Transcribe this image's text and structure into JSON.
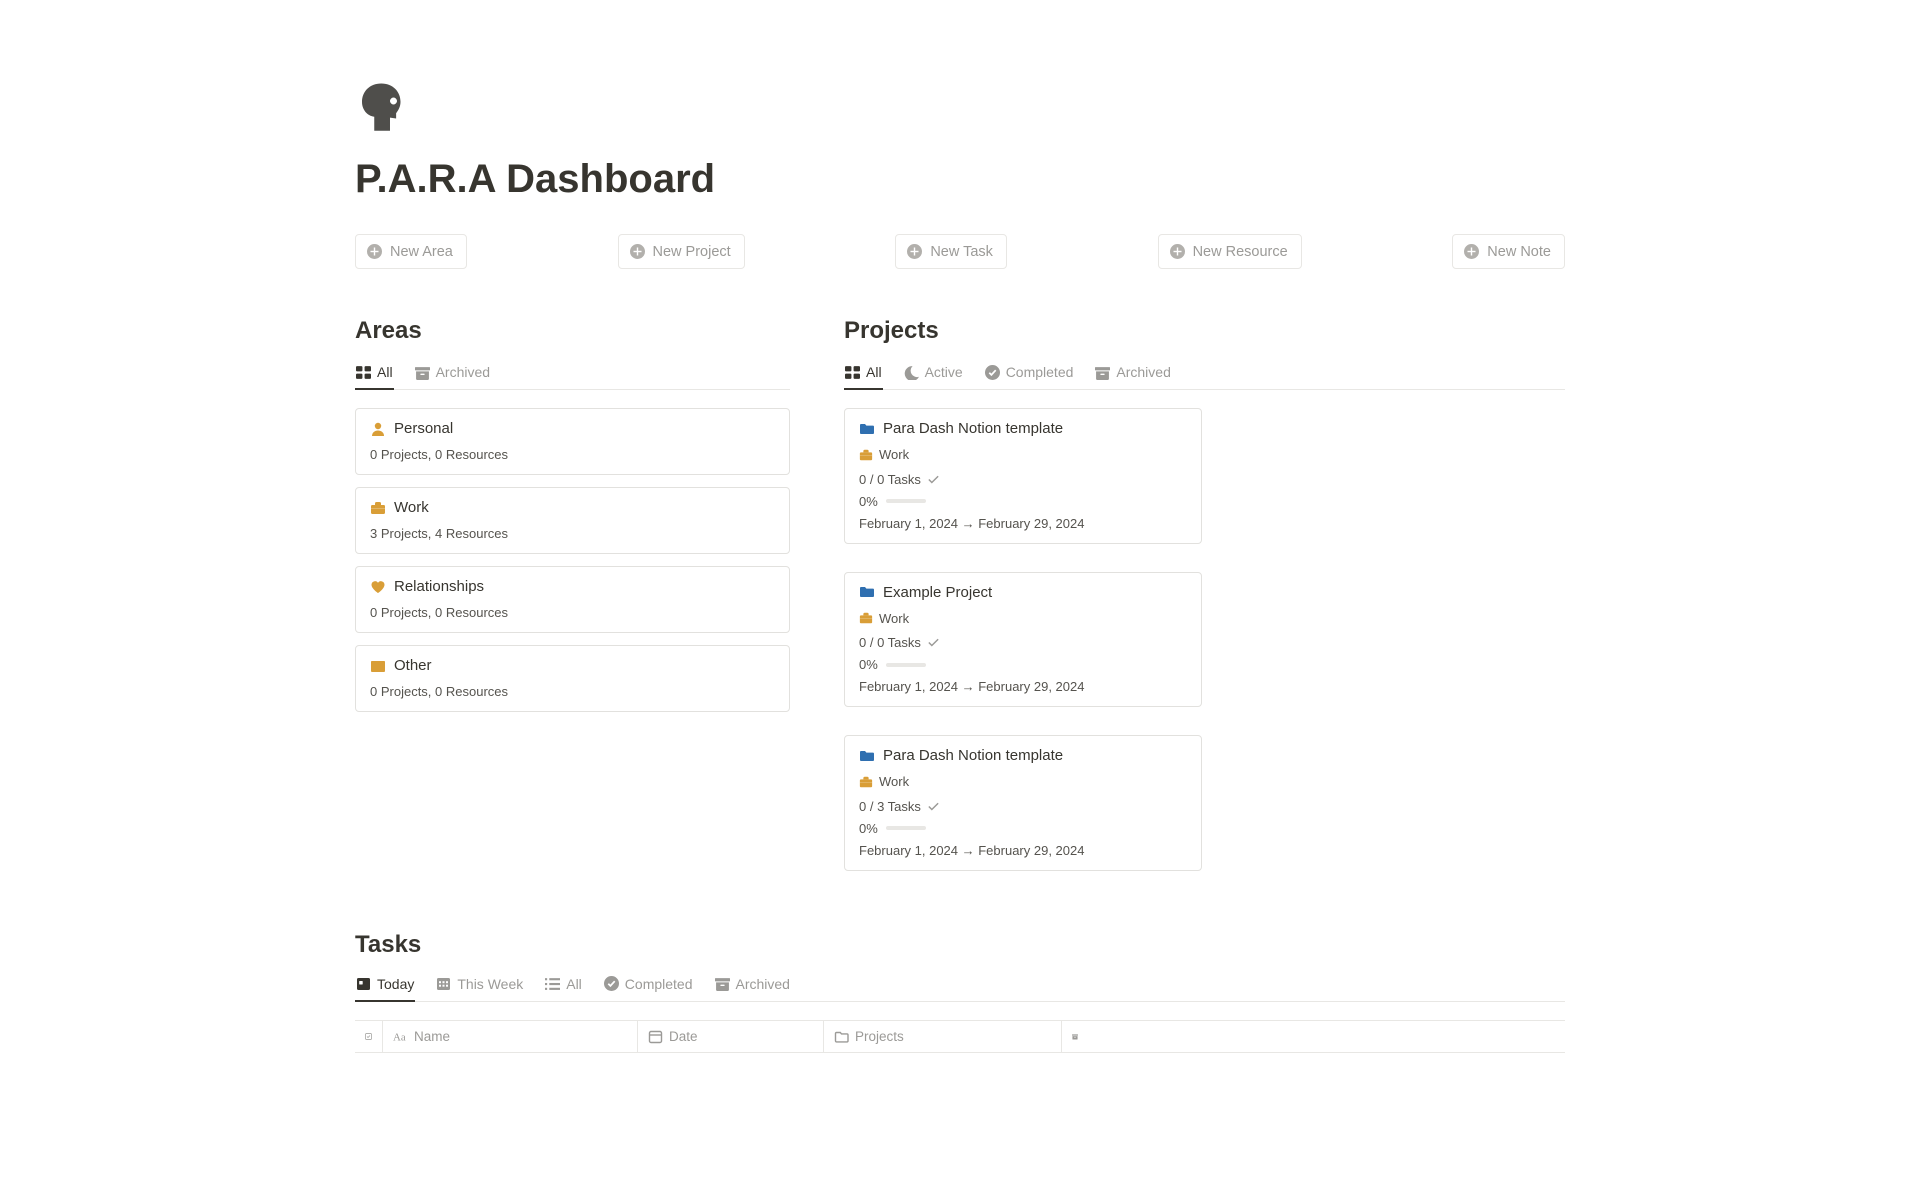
{
  "page": {
    "title": "P.A.R.A Dashboard"
  },
  "actions": {
    "new_area": "New Area",
    "new_project": "New Project",
    "new_task": "New Task",
    "new_resource": "New Resource",
    "new_note": "New Note"
  },
  "areas": {
    "heading": "Areas",
    "tabs": {
      "all": "All",
      "archived": "Archived"
    },
    "items": [
      {
        "name": "Personal",
        "meta": "0 Projects, 0 Resources",
        "icon": "person",
        "color": "#d99e37"
      },
      {
        "name": "Work",
        "meta": "3 Projects, 4 Resources",
        "icon": "briefcase",
        "color": "#d99e37"
      },
      {
        "name": "Relationships",
        "meta": "0 Projects, 0 Resources",
        "icon": "heart",
        "color": "#d99e37"
      },
      {
        "name": "Other",
        "meta": "0 Projects, 0 Resources",
        "icon": "archive-box",
        "color": "#d99e37"
      }
    ]
  },
  "projects": {
    "heading": "Projects",
    "tabs": {
      "all": "All",
      "active": "Active",
      "completed": "Completed",
      "archived": "Archived"
    },
    "items": [
      {
        "name": "Para Dash Notion template",
        "area": "Work",
        "tasks_text": "0 / 0 Tasks",
        "pct": "0%",
        "dates": "February 1, 2024 → February 29, 2024"
      },
      {
        "name": "Example Project",
        "area": "Work",
        "tasks_text": "0 / 0 Tasks",
        "pct": "0%",
        "dates": "February 1, 2024 → February 29, 2024"
      },
      {
        "name": "Para Dash Notion template",
        "area": "Work",
        "tasks_text": "0 / 3 Tasks",
        "pct": "0%",
        "dates": "February 1, 2024 → February 29, 2024"
      }
    ]
  },
  "tasks": {
    "heading": "Tasks",
    "tabs": {
      "today": "Today",
      "this_week": "This Week",
      "all": "All",
      "completed": "Completed",
      "archived": "Archived"
    },
    "columns": {
      "name": "Name",
      "date": "Date",
      "projects": "Projects"
    }
  }
}
